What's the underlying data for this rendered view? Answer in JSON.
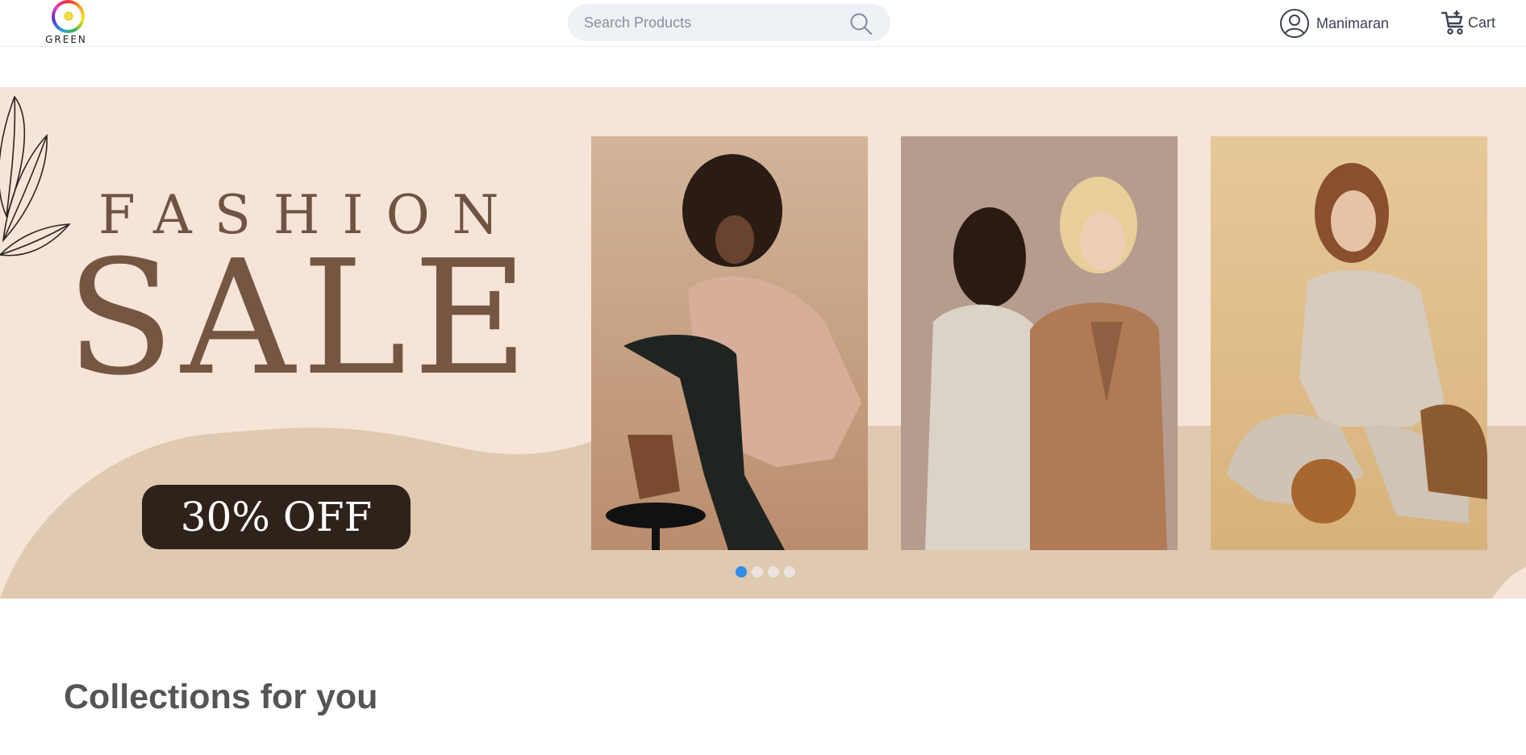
{
  "header": {
    "logo_text": "GREEN",
    "search_placeholder": "Search Products",
    "user_name": "Manimaran",
    "cart_label": "Cart"
  },
  "banner": {
    "headline_small": "FASHION",
    "headline_large": "SALE",
    "offer": "30% OFF",
    "slides": [
      {
        "active": true
      },
      {
        "active": false
      },
      {
        "active": false
      },
      {
        "active": false
      }
    ],
    "colors": {
      "background": "#f6e4d8",
      "wave": "#dfc9b0",
      "accent_text": "#745643",
      "offer_bg": "#2f221a",
      "active_dot": "#2f8ce8"
    }
  },
  "main": {
    "section_title": "Collections for you"
  }
}
